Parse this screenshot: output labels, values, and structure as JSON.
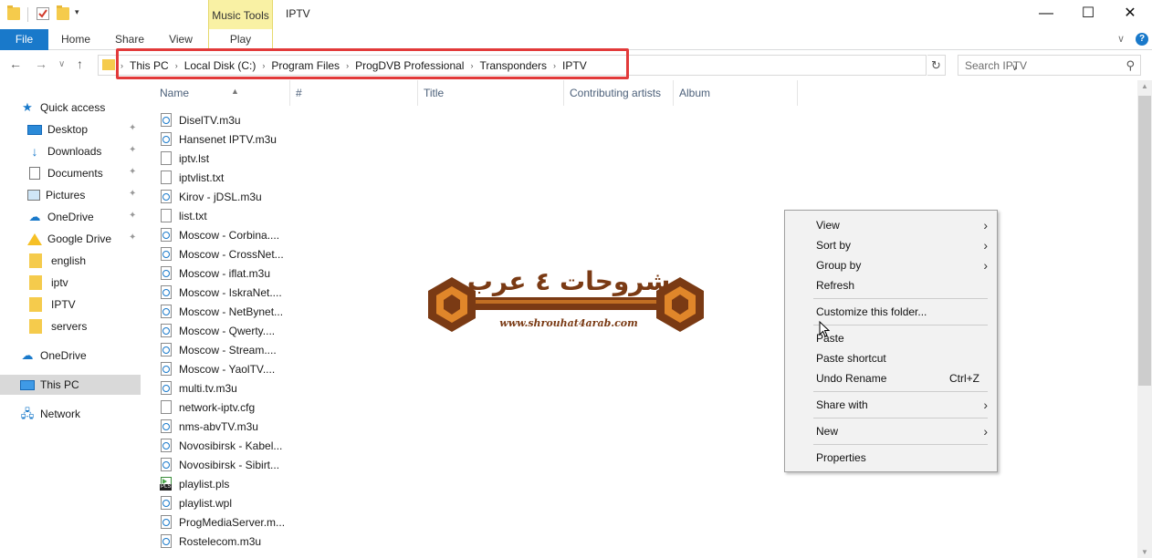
{
  "window": {
    "title": "IPTV",
    "context_tab": "Music Tools",
    "minimize": "—",
    "maximize": "☐",
    "close": "✕"
  },
  "ribbon": {
    "tabs": [
      "File",
      "Home",
      "Share",
      "View",
      "Play"
    ],
    "collapse_glyph": "∨",
    "help_glyph": "?"
  },
  "address": {
    "breadcrumbs": [
      "This PC",
      "Local Disk (C:)",
      "Program Files",
      "ProgDVB Professional",
      "Transponders",
      "IPTV"
    ],
    "separator": "›",
    "search_placeholder": "Search IPTV",
    "refresh_glyph": "↻",
    "dropdown_glyph": "∨"
  },
  "nav": {
    "back": "←",
    "forward": "→",
    "recent": "∨",
    "up": "↑"
  },
  "sidebar": {
    "items": [
      {
        "label": "Quick access",
        "icon": "star-icon",
        "pinned": false
      },
      {
        "label": "Desktop",
        "icon": "desktop-icon",
        "pinned": true
      },
      {
        "label": "Downloads",
        "icon": "download-icon",
        "pinned": true
      },
      {
        "label": "Documents",
        "icon": "document-icon",
        "pinned": true
      },
      {
        "label": "Pictures",
        "icon": "picture-icon",
        "pinned": true
      },
      {
        "label": "OneDrive",
        "icon": "cloud-icon",
        "pinned": true
      },
      {
        "label": "Google Drive",
        "icon": "google-drive-icon",
        "pinned": true
      },
      {
        "label": "english",
        "icon": "folder-icon",
        "pinned": false
      },
      {
        "label": "iptv",
        "icon": "folder-icon",
        "pinned": false
      },
      {
        "label": "IPTV",
        "icon": "folder-icon",
        "pinned": false
      },
      {
        "label": "servers",
        "icon": "folder-icon",
        "pinned": false
      },
      {
        "label": "OneDrive",
        "icon": "cloud-icon",
        "pinned": false
      },
      {
        "label": "This PC",
        "icon": "computer-icon",
        "pinned": false,
        "selected": true
      },
      {
        "label": "Network",
        "icon": "network-icon",
        "pinned": false
      }
    ],
    "pin_glyph": "📌"
  },
  "columns": [
    "Name",
    "#",
    "Title",
    "Contributing artists",
    "Album"
  ],
  "files": [
    {
      "name": "DiselTV.m3u",
      "type": "media"
    },
    {
      "name": "Hansenet IPTV.m3u",
      "type": "media"
    },
    {
      "name": "iptv.lst",
      "type": "text"
    },
    {
      "name": "iptvlist.txt",
      "type": "text"
    },
    {
      "name": "Kirov - jDSL.m3u",
      "type": "media"
    },
    {
      "name": "list.txt",
      "type": "text"
    },
    {
      "name": "Moscow - Corbina....",
      "type": "media"
    },
    {
      "name": "Moscow - CrossNet...",
      "type": "media"
    },
    {
      "name": "Moscow - iflat.m3u",
      "type": "media"
    },
    {
      "name": "Moscow - IskraNet....",
      "type": "media"
    },
    {
      "name": "Moscow - NetBynet...",
      "type": "media"
    },
    {
      "name": "Moscow - Qwerty....",
      "type": "media"
    },
    {
      "name": "Moscow - Stream....",
      "type": "media"
    },
    {
      "name": "Moscow - YaolTV....",
      "type": "media"
    },
    {
      "name": "multi.tv.m3u",
      "type": "media"
    },
    {
      "name": "network-iptv.cfg",
      "type": "text"
    },
    {
      "name": "nms-abvTV.m3u",
      "type": "media"
    },
    {
      "name": "Novosibirsk - Kabel...",
      "type": "media"
    },
    {
      "name": "Novosibirsk - Sibirt...",
      "type": "media"
    },
    {
      "name": "playlist.pls",
      "type": "pls"
    },
    {
      "name": "playlist.wpl",
      "type": "media"
    },
    {
      "name": "ProgMediaServer.m...",
      "type": "media"
    },
    {
      "name": "Rostelecom.m3u",
      "type": "media"
    }
  ],
  "context_menu": {
    "items": [
      {
        "label": "View",
        "submenu": true
      },
      {
        "label": "Sort by",
        "submenu": true
      },
      {
        "label": "Group by",
        "submenu": true
      },
      {
        "label": "Refresh",
        "submenu": false
      },
      {
        "label": "Customize this folder...",
        "submenu": false
      },
      {
        "label": "Paste",
        "submenu": false
      },
      {
        "label": "Paste shortcut",
        "submenu": false
      },
      {
        "label": "Undo Rename",
        "submenu": false,
        "shortcut": "Ctrl+Z"
      },
      {
        "label": "Share with",
        "submenu": true
      },
      {
        "label": "New",
        "submenu": true
      },
      {
        "label": "Properties",
        "submenu": false
      }
    ],
    "submenu_glyph": "›"
  },
  "watermark": {
    "arabic": "شروحات ٤ عرب",
    "url": "www.shrouhat4arab.com"
  },
  "colors": {
    "accent": "#1979ca",
    "music_tools": "#f9f1a4",
    "highlight_box": "#e23a3a",
    "watermark_brown": "#7a3a14",
    "watermark_orange": "#e0862a"
  }
}
